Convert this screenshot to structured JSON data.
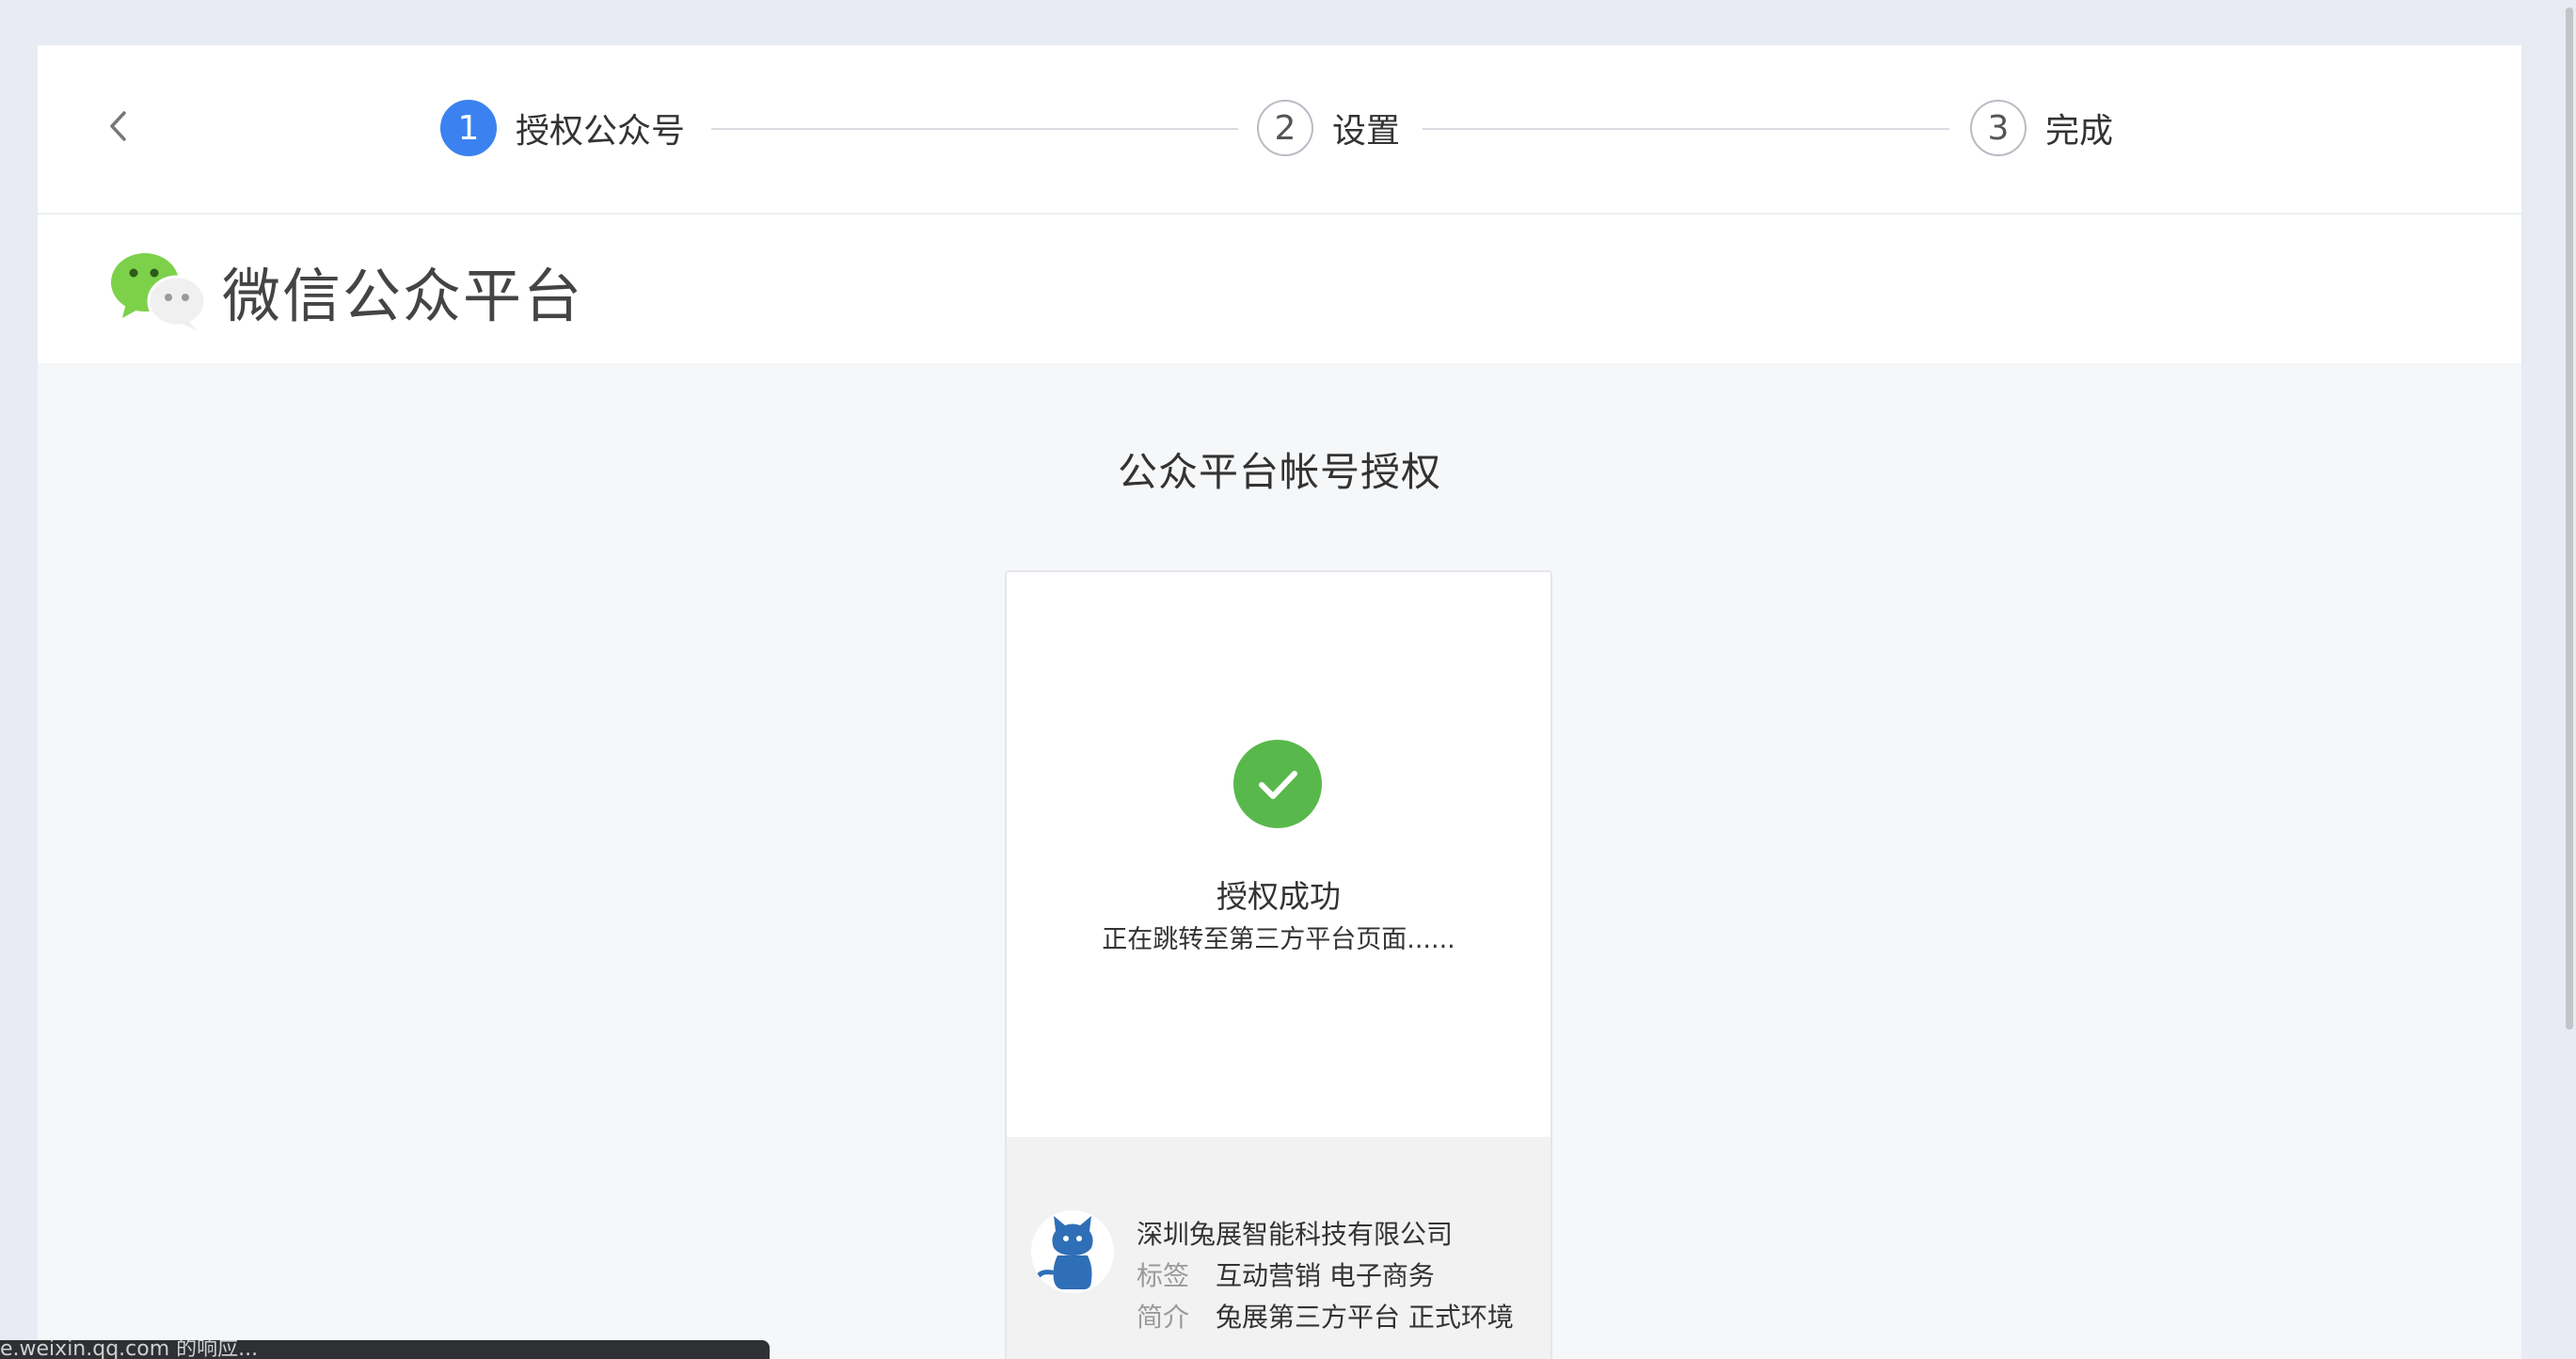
{
  "stepper": {
    "back_icon": "chevron-left-icon",
    "steps": [
      {
        "number": "1",
        "label": "授权公众号",
        "state": "active"
      },
      {
        "number": "2",
        "label": "设置",
        "state": "pending"
      },
      {
        "number": "3",
        "label": "完成",
        "state": "pending"
      }
    ]
  },
  "platform": {
    "logo_icon": "wechat-logo-icon",
    "title": "微信公众平台"
  },
  "main": {
    "title": "公众平台帐号授权"
  },
  "card": {
    "status_icon": "check-circle-icon",
    "status_title": "授权成功",
    "status_sub": "正在跳转至第三方平台页面......",
    "account": {
      "avatar_icon": "cat-avatar-icon",
      "name": "深圳兔展智能科技有限公司",
      "tags_label": "标签",
      "tags_value": "互动营销 电子商务",
      "intro_label": "简介",
      "intro_value": "兔展第三方平台 正式环境"
    }
  },
  "statusbar": {
    "text": "e.weixin.qq.com 的响应..."
  },
  "colors": {
    "accent": "#3b82f0",
    "success": "#59b84b",
    "wechat_green": "#7dd14a",
    "avatar_blue": "#2f6fb7",
    "page_bg": "#f6f7f9"
  }
}
